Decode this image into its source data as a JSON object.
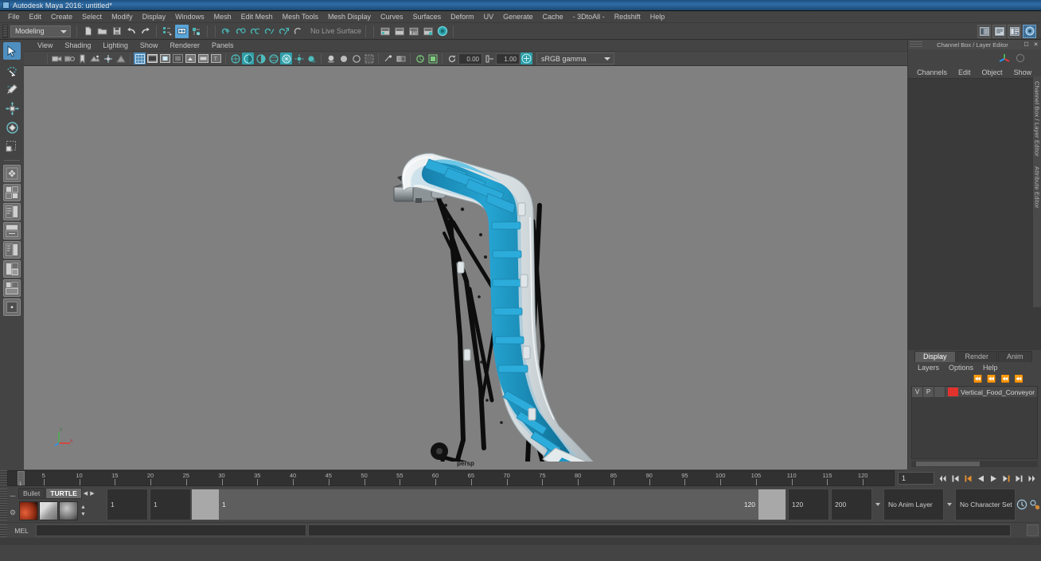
{
  "window": {
    "title": "Autodesk Maya 2016: untitled*",
    "icon": "maya-app-icon"
  },
  "menubar": {
    "items": [
      "File",
      "Edit",
      "Create",
      "Select",
      "Modify",
      "Display",
      "Windows",
      "Mesh",
      "Edit Mesh",
      "Mesh Tools",
      "Mesh Display",
      "Curves",
      "Surfaces",
      "Deform",
      "UV",
      "Generate",
      "Cache",
      "- 3DtoAll -",
      "Redshift",
      "Help"
    ]
  },
  "statusbar": {
    "mode": "Modeling",
    "live_surface": "No Live Surface",
    "icons": [
      "new-scene-icon",
      "open-scene-icon",
      "save-scene-icon",
      "undo-icon",
      "redo-icon",
      "select-by-hierarchy-icon",
      "select-by-object-icon",
      "select-by-component-icon",
      "snap-to-grid-icon",
      "snap-to-curve-icon",
      "snap-to-point-icon",
      "snap-to-projected-center-icon",
      "snap-to-view-plane-icon",
      "make-live-icon",
      "show-render-view-icon",
      "render-current-frame-icon",
      "ipr-render-icon",
      "render-settings-icon",
      "hypershade-icon"
    ],
    "right_icons": [
      "toggle-channel-box-icon",
      "toggle-attribute-editor-icon",
      "toggle-tool-settings-icon",
      "toggle-modeling-toolkit-icon"
    ]
  },
  "toolbox": {
    "tools": [
      {
        "name": "select-tool",
        "glyph": "⬈",
        "active": true
      },
      {
        "name": "lasso-select-tool",
        "glyph": "⤵",
        "active": false
      },
      {
        "name": "paint-select-tool",
        "glyph": "✎",
        "active": false
      },
      {
        "name": "move-tool",
        "glyph": "✥",
        "active": false
      },
      {
        "name": "rotate-tool",
        "glyph": "◈",
        "active": false
      },
      {
        "name": "scale-tool",
        "glyph": "▣",
        "active": false
      }
    ],
    "layout_buttons": [
      "single-perspective-view-icon",
      "four-view-layout-icon",
      "two-pane-side-icon",
      "outliner-persp-layout-icon",
      "hypergraph-persp-layout-icon",
      "persp-graph-layout-icon",
      "outliner-graph-layout-icon",
      "persp-outliner-layout-icon",
      "dot-layout-icon"
    ]
  },
  "panel": {
    "menus": [
      "View",
      "Shading",
      "Lighting",
      "Show",
      "Renderer",
      "Panels"
    ],
    "gamma": "sRGB gamma",
    "exposure": "0.00",
    "gamma_value": "1.00",
    "viewport_label": "persp",
    "icons": [
      "camera-icon",
      "camera-attributes-icon",
      "bookmark-icon",
      "image-plane-icon",
      "two-sided-lighting-icon",
      "shadows-icon",
      "grid-icon",
      "film-gate-icon",
      "resolution-gate-icon",
      "gate-mask-icon",
      "exposure-icon",
      "gamma-icon",
      "wireframe-icon",
      "smooth-shade-icon",
      "flat-shade-icon",
      "shaded-wireframe-icon",
      "textured-icon",
      "use-all-lights-icon",
      "shadows-toggle-icon",
      "ambient-occlusion-icon",
      "motion-blur-icon",
      "isolate-select-icon",
      "xray-icon",
      "xray-joints-icon",
      "xray-active-components-icon"
    ]
  },
  "right_panel": {
    "title": "Channel Box / Layer Editor",
    "menus": [
      "Channels",
      "Edit",
      "Object",
      "Show"
    ],
    "side_tabs": [
      "Channel Box / Layer Editor",
      "Attribute Editor"
    ],
    "float_icon": "float-window-icon",
    "close_icon": "close-icon"
  },
  "layer_editor": {
    "tabs": [
      {
        "label": "Display",
        "selected": true
      },
      {
        "label": "Render",
        "selected": false
      },
      {
        "label": "Anim",
        "selected": false
      }
    ],
    "menus": [
      "Layers",
      "Options",
      "Help"
    ],
    "toolbar_icons": [
      "layer-first-icon",
      "layer-prev-icon",
      "layer-next-icon",
      "layer-last-icon"
    ],
    "layers": [
      {
        "visibility": "V",
        "playback": "P",
        "color": "#e2322e",
        "name": "Vertical_Food_Conveyor"
      }
    ]
  },
  "timeline": {
    "ticks": [
      5,
      10,
      15,
      20,
      25,
      30,
      35,
      40,
      45,
      50,
      55,
      60,
      65,
      70,
      75,
      80,
      85,
      90,
      95,
      100,
      105,
      110,
      115,
      120
    ],
    "current_frame": "1",
    "current_frame_field": "1",
    "playback_buttons": [
      {
        "name": "go-to-start-button",
        "glyph": "⏮"
      },
      {
        "name": "step-back-keyframe-button",
        "glyph": "⏴|"
      },
      {
        "name": "step-back-frame-button",
        "glyph": "|◀",
        "highlight": true
      },
      {
        "name": "play-backwards-button",
        "glyph": "◀"
      },
      {
        "name": "play-forwards-button",
        "glyph": "▶"
      },
      {
        "name": "step-forward-frame-button",
        "glyph": "▶|"
      },
      {
        "name": "step-forward-keyframe-button",
        "glyph": "▶|"
      },
      {
        "name": "go-to-end-button",
        "glyph": "⏭"
      }
    ]
  },
  "range_slider": {
    "start_field": "1",
    "end_field": "1",
    "range_start_label": "1",
    "range_end_label": "120",
    "playback_end": "120",
    "anim_end": "200",
    "anim_layer": "No Anim Layer",
    "character_set": "No Character Set",
    "buttons": [
      "auto-keyframe-button",
      "animation-preferences-button"
    ]
  },
  "shelf": {
    "tabs": [
      {
        "label": "Bullet",
        "selected": false
      },
      {
        "label": "TURTLE",
        "selected": true
      }
    ],
    "nav": [
      "shelf-prev-icon",
      "shelf-next-icon"
    ],
    "items": [
      "turtle-render-icon",
      "turtle-bake-icon",
      "turtle-shader-icon"
    ],
    "menu_icon": "shelf-menu-icon",
    "settings_icon": "shelf-settings-icon"
  },
  "command_line": {
    "language": "MEL",
    "input_value": "",
    "output_value": "",
    "help_icon": "help-icon"
  },
  "colors": {
    "viewport_bg": "#808080",
    "accent_blue": "#4f8fc0",
    "title_blue": "#2f6da8",
    "layer_red": "#e2322e",
    "model_cyan": "#1e9bc8",
    "model_white": "#dfe4e6",
    "highlight_orange": "#e59030"
  },
  "model": {
    "name": "Vertical_Food_Conveyor",
    "description": "3D vertical food conveyor with cyan belt, white housing and black steel frame on casters"
  }
}
